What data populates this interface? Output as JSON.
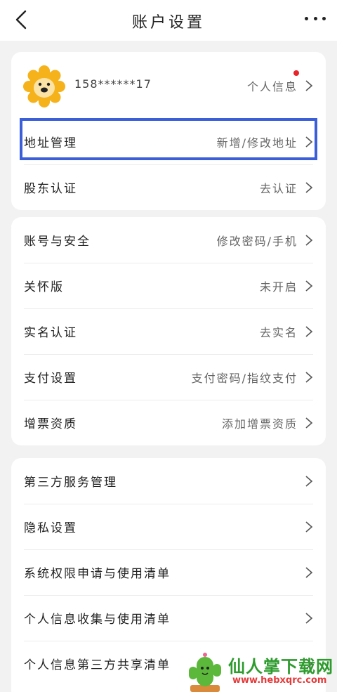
{
  "header": {
    "title": "账户设置"
  },
  "card1": {
    "profile": {
      "phone": "158******17",
      "label": "个人信息"
    },
    "address": {
      "label": "地址管理",
      "value": "新增/修改地址"
    },
    "shareholder": {
      "label": "股东认证",
      "value": "去认证"
    }
  },
  "card2": {
    "items": [
      {
        "label": "账号与安全",
        "value": "修改密码/手机"
      },
      {
        "label": "关怀版",
        "value": "未开启"
      },
      {
        "label": "实名认证",
        "value": "去实名"
      },
      {
        "label": "支付设置",
        "value": "支付密码/指纹支付"
      },
      {
        "label": "增票资质",
        "value": "添加增票资质"
      }
    ]
  },
  "card3": {
    "items": [
      {
        "label": "第三方服务管理"
      },
      {
        "label": "隐私设置"
      },
      {
        "label": "系统权限申请与使用清单"
      },
      {
        "label": "个人信息收集与使用清单"
      },
      {
        "label": "个人信息第三方共享清单"
      }
    ]
  },
  "watermark": {
    "text": "仙人掌下载网",
    "url": "www.hebxqrc.com"
  },
  "colors": {
    "highlight": "#3b5fd8",
    "badge": "#e8232a",
    "avatar": "#f6b21a"
  }
}
